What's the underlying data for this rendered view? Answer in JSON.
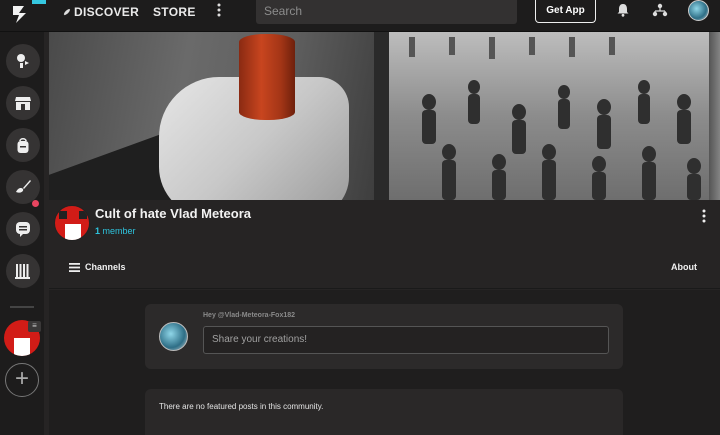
{
  "topbar": {
    "discover_label": "DISCOVER",
    "store_label": "STORE",
    "search_placeholder": "Search",
    "get_app_label": "Get App"
  },
  "sidebar": {
    "items": [
      {
        "name": "feed",
        "icon": "chat-user-icon"
      },
      {
        "name": "store",
        "icon": "storefront-icon"
      },
      {
        "name": "backpack",
        "icon": "backpack-icon"
      },
      {
        "name": "create",
        "icon": "paint-icon"
      },
      {
        "name": "messages",
        "icon": "chat-icon"
      },
      {
        "name": "library",
        "icon": "library-icon"
      }
    ],
    "community_badge": "≡",
    "add_label": "+"
  },
  "community": {
    "title": "Cult of hate Vlad Meteora",
    "member_count": "1",
    "member_label": "member",
    "accent_color": "#d21c17"
  },
  "tabs": {
    "channels_label": "Channels",
    "about_label": "About"
  },
  "composer": {
    "greeting": "Hey @Vlad-Meteora-Fox182",
    "placeholder": "Share your creations!"
  },
  "feed": {
    "empty_message": "There are no featured posts in this community."
  },
  "colors": {
    "accent_cyan": "#2ec3dd",
    "notification": "#e84560",
    "background": "#262424"
  }
}
